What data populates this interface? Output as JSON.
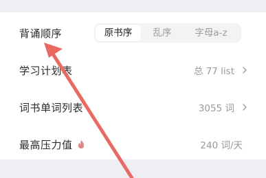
{
  "settings": {
    "recite_order": {
      "label": "背诵顺序",
      "options": [
        "原书序",
        "乱序",
        "字母a-z"
      ],
      "selected": "原书序"
    },
    "study_plan": {
      "label": "学习计划表",
      "value": "总 77 list"
    },
    "word_list": {
      "label": "词书单词列表",
      "value": "3055 词"
    },
    "max_pressure": {
      "label": "最高压力值",
      "value": "240 词/天",
      "icon": "flame-icon"
    }
  },
  "colors": {
    "background": "#eeeff2",
    "card": "#ffffff",
    "annotation_arrow": "#e96a63",
    "flame": "#d98a86"
  }
}
